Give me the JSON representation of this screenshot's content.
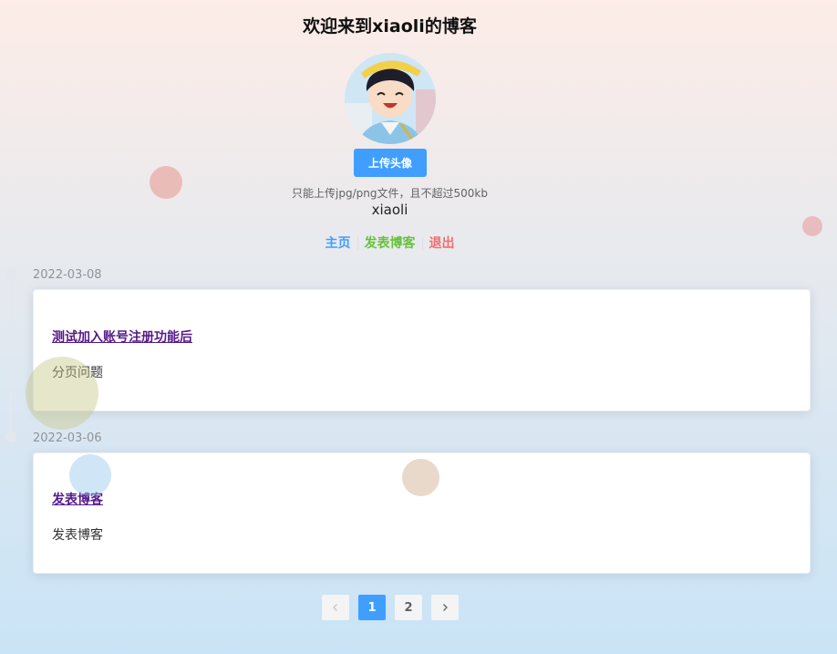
{
  "header": {
    "title": "欢迎来到xiaoli的博客",
    "upload_label": "上传头像",
    "upload_tip": "只能上传jpg/png文件，且不超过500kb",
    "username": "xiaoli"
  },
  "nav": {
    "home": "主页",
    "post": "发表博客",
    "logout": "退出"
  },
  "posts": [
    {
      "date": "2022-03-08",
      "title": "测试加入账号注册功能后",
      "summary": "分页问题"
    },
    {
      "date": "2022-03-06",
      "title": "发表博客",
      "summary": "发表博客"
    }
  ],
  "pagination": {
    "pages": [
      "1",
      "2"
    ],
    "current": "1",
    "prev_icon": "chevron-left-icon",
    "next_icon": "chevron-right-icon"
  },
  "colors": {
    "primary": "#409eff",
    "success": "#67c23a",
    "danger": "#f56c6c",
    "visited_link": "#551a8b"
  }
}
